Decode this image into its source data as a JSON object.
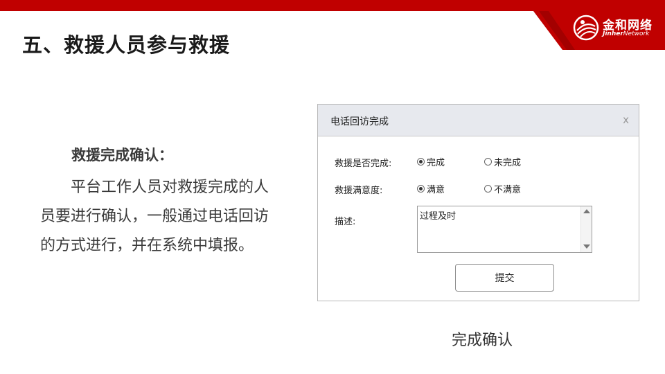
{
  "header": {
    "logo_cn": "金和网络",
    "logo_en_bold": "Jinher",
    "logo_en_rest": "Network",
    "brand_color": "#c00000",
    "logo_icon": "globe-swoosh-icon"
  },
  "page_title": "五、救援人员参与救援",
  "section": {
    "heading": "救援完成确认：",
    "body": "平台工作人员对救援完成的人员要进行确认，一般通过电话回访的方式进行，并在系统中填报。"
  },
  "dialog": {
    "title": "电话回访完成",
    "close_label": "x",
    "fields": {
      "completed": {
        "label": "救援是否完成:",
        "options": [
          "完成",
          "未完成"
        ],
        "selected": "完成"
      },
      "satisfaction": {
        "label": "救援满意度:",
        "options": [
          "满意",
          "不满意"
        ],
        "selected": "满意"
      },
      "description": {
        "label": "描述:",
        "value": "过程及时"
      }
    },
    "submit_label": "提交"
  },
  "caption": "完成确认"
}
